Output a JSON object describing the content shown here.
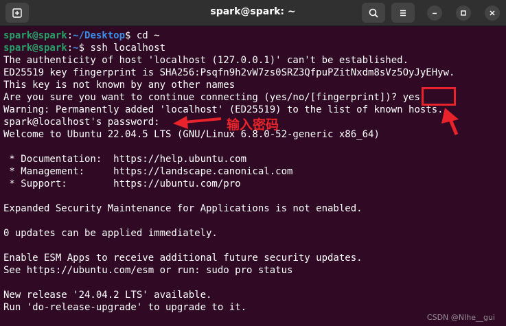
{
  "window": {
    "title": "spark@spark: ~"
  },
  "icons": {
    "new_tab": "new-tab-icon",
    "search": "search-icon",
    "menu": "hamburger-menu-icon",
    "minimize": "minimize-icon",
    "maximize": "maximize-icon",
    "close": "close-icon"
  },
  "terminal": {
    "prompt1": {
      "user": "spark@spark",
      "sep": ":",
      "path": "~/Desktop",
      "dollar": "$",
      "command": " cd ~"
    },
    "prompt2": {
      "user": "spark@spark",
      "sep": ":",
      "path": "~",
      "dollar": "$",
      "command": " ssh localhost"
    },
    "lines": {
      "l3": "The authenticity of host 'localhost (127.0.0.1)' can't be established.",
      "l4": "ED25519 key fingerprint is SHA256:Psqfn9h2vW7zs0SRZ3QfpuPZitNxdm8sVz5OyJyEHyw.",
      "l5": "This key is not known by any other names",
      "l6": "Are you sure you want to continue connecting (yes/no/[fingerprint])? yes",
      "l7": "Warning: Permanently added 'localhost' (ED25519) to the list of known hosts.",
      "l8": "spark@localhost's password:",
      "l9": "Welcome to Ubuntu 22.04.5 LTS (GNU/Linux 6.8.0-52-generic x86_64)",
      "l11": " * Documentation:  https://help.ubuntu.com",
      "l12": " * Management:     https://landscape.canonical.com",
      "l13": " * Support:        https://ubuntu.com/pro",
      "l15": "Expanded Security Maintenance for Applications is not enabled.",
      "l17": "0 updates can be applied immediately.",
      "l19": "Enable ESM Apps to receive additional future security updates.",
      "l20": "See https://ubuntu.com/esm or run: sudo pro status",
      "l22": "New release '24.04.2 LTS' available.",
      "l23": "Run 'do-release-upgrade' to upgrade to it."
    }
  },
  "annotations": {
    "password_label": "输入密码",
    "color": "#e8232b"
  },
  "watermark": "CSDN @NIhe__gui"
}
